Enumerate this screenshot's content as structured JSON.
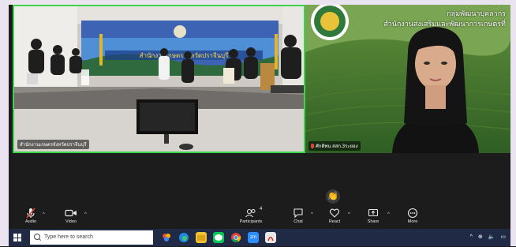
{
  "meeting": {
    "left_tile": {
      "banner_text": "สำนักงานเกษตรจังหวัดปราจีนบุรี",
      "participant_name": "สำนักงานเกษตรจังหวัดปราจีนบุรี"
    },
    "right_tile": {
      "org_line1": "กลุ่มพัฒนาบุคลากร",
      "org_line2": "สำนักงานส่งเสริมและพัฒนาการเกษตรที่",
      "participant_name": "ศักดิพน สสก.3ระยอง"
    },
    "reaction_emoji": "👏"
  },
  "toolbar": {
    "audio_label": "Audio",
    "video_label": "Video",
    "participants_label": "Participants",
    "participants_count": "4",
    "chat_label": "Chat",
    "react_label": "React",
    "share_label": "Share",
    "more_label": "More"
  },
  "taskbar": {
    "search_placeholder": "Type here to search",
    "zoom_badge": "zm"
  },
  "colors": {
    "active_speaker": "#3fd24b",
    "toolbar_bg": "#1c1c1c",
    "taskbar_bg": "#202a44",
    "muted_red": "#e0453b"
  }
}
